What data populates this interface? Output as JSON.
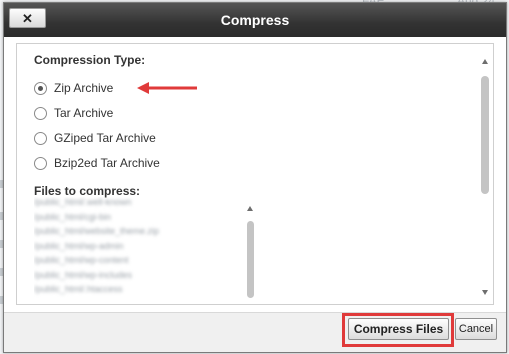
{
  "background": {
    "fragments": [
      "FAE",
      "Aug 24"
    ]
  },
  "dialog": {
    "title": "Compress",
    "close_icon": "close-icon",
    "compression_type_label": "Compression Type:",
    "options": [
      {
        "label": "Zip Archive",
        "checked": true
      },
      {
        "label": "Tar Archive",
        "checked": false
      },
      {
        "label": "GZiped Tar Archive",
        "checked": false
      },
      {
        "label": "Bzip2ed Tar Archive",
        "checked": false
      }
    ],
    "files_label": "Files to compress:",
    "files": [
      "/public_html/.well-known",
      "/public_html/cgi-bin",
      "/public_html/website_theme.zip",
      "/public_html/wp-admin",
      "/public_html/wp-content",
      "/public_html/wp-includes",
      "/public_html/.htaccess"
    ],
    "compress_button": "Compress Files",
    "cancel_button": "Cancel"
  },
  "colors": {
    "titlebar": "#333333",
    "annotation": "#e03a3a"
  }
}
